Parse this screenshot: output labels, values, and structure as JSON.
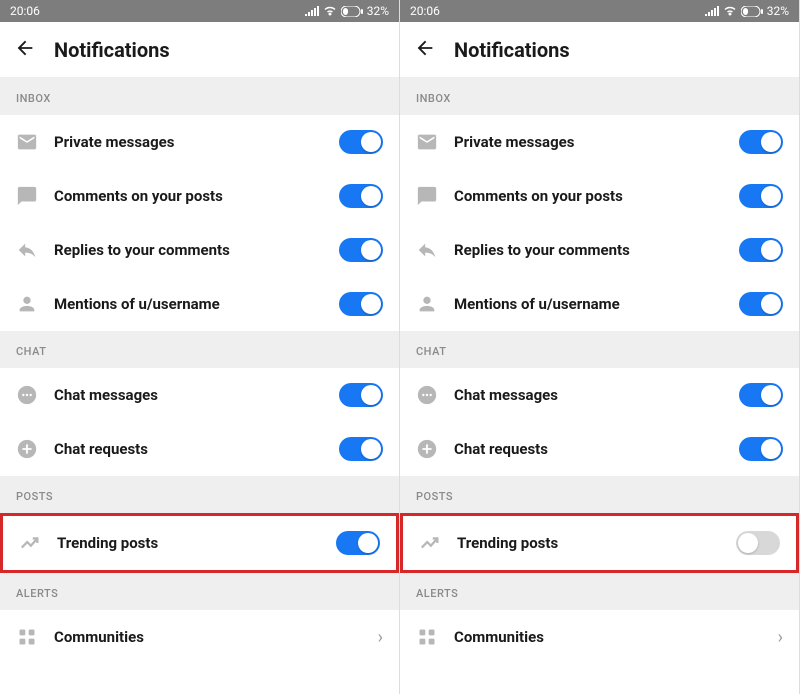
{
  "status": {
    "time": "20:06",
    "battery_pct": "32%"
  },
  "header": {
    "title": "Notifications"
  },
  "sections": {
    "inbox": {
      "label": "INBOX",
      "private_messages": "Private messages",
      "comments": "Comments on your posts",
      "replies": "Replies to your comments",
      "mentions": "Mentions of u/username"
    },
    "chat": {
      "label": "CHAT",
      "messages": "Chat messages",
      "requests": "Chat requests"
    },
    "posts": {
      "label": "POSTS",
      "trending": "Trending posts"
    },
    "alerts": {
      "label": "ALERTS",
      "communities": "Communities"
    }
  },
  "left": {
    "trending_toggle": "on"
  },
  "right": {
    "trending_toggle": "off"
  }
}
